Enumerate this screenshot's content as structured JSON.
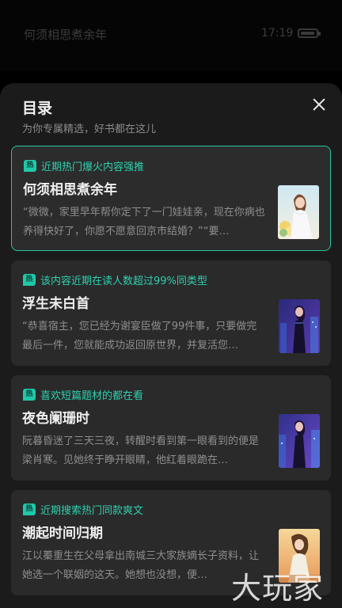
{
  "status": {
    "title": "何须相思煮余年",
    "time": "17:19"
  },
  "sheet": {
    "title": "目录",
    "subtitle": "为你专属精选，好书都在这儿"
  },
  "books": [
    {
      "hot_label": "热",
      "tag": "近期热门爆火内容强推",
      "title": "何须相思煮余年",
      "desc": "“微微，家里早年帮你定下了一门娃娃亲，现在你病也养得快好了，你愿不愿意回京市结婚？”“要…",
      "selected": true,
      "cover_icon": "bride-flowers-cover"
    },
    {
      "hot_label": "热",
      "tag": "该内容近期在读人数超过99%同类型",
      "title": "浮生未白首",
      "desc": "“恭喜宿主，您已经为谢宴臣做了99件事，只要做完最后一件，您就能成功返回原世界，并复活您…",
      "selected": false,
      "cover_icon": "night-city-woman-cover"
    },
    {
      "hot_label": "热",
      "tag": "喜欢短篇题材的都在看",
      "title": "夜色阑珊时",
      "desc": "阮暮昏迷了三天三夜，转醒时看到第一眼看到的便是梁肖寒。见她终于睁开眼睛，他红着眼跪在…",
      "selected": false,
      "cover_icon": "night-city-woman-cover"
    },
    {
      "hot_label": "热",
      "tag": "近期搜索热门同款爽文",
      "title": "潮起时间归期",
      "desc": "江以蓁重生在父母拿出南城三大家族嫡长子资料，让她选一个联姻的这天。她想也没想，便…",
      "selected": false,
      "cover_icon": "sunset-girl-cover"
    }
  ],
  "watermark": "大玩家"
}
